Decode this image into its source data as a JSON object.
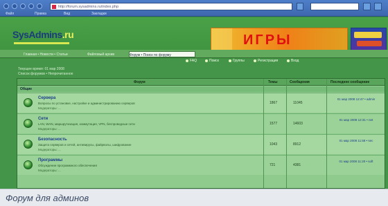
{
  "browser": {
    "url": "http://forum.sysadmins.ru/index.php",
    "menu": [
      "Файл",
      "Правка",
      "Вид",
      "Закладки"
    ]
  },
  "header": {
    "logo_main": "SysAdmins",
    "logo_tld": ".ru",
    "banner_text": "ИГРЫ"
  },
  "tabs": [
    {
      "label": "Главная • Новости • Статьи"
    },
    {
      "label": "Файловый архив"
    },
    {
      "label": "Форум • Поиск по форуму"
    },
    {
      "label": ""
    }
  ],
  "actions": [
    "FAQ",
    "Поиск",
    "Группы",
    "Регистрация",
    "Вход"
  ],
  "crumbs": {
    "line1": "Текущее время: 01 мар 2008",
    "line2": "Список форумов • Непрочитанное"
  },
  "table": {
    "headers": {
      "forum": "Форум",
      "topics": "Темы",
      "posts": "Сообщения",
      "last": "Последнее сообщение"
    },
    "category": "Общие",
    "rows": [
      {
        "title": "Сервера",
        "desc": "Вопросы по установке, настройке и администрированию серверов",
        "mods": "Модераторы: ...",
        "topics": "1867",
        "posts": "11045",
        "last": "01 мар 2008 12:47 • admin"
      },
      {
        "title": "Сети",
        "desc": "LAN, WAN, маршрутизация, коммутация, VPN, беспроводные сети",
        "mods": "Модераторы: ...",
        "topics": "1577",
        "posts": "14603",
        "last": "01 мар 2008 12:31 • net"
      },
      {
        "title": "Безопасность",
        "desc": "Защита серверов и сетей, антивирусы, файрволы, шифрование",
        "mods": "Модераторы: ...",
        "topics": "1043",
        "posts": "8912",
        "last": "01 мар 2008 11:58 • sec"
      },
      {
        "title": "Программы",
        "desc": "Обсуждение программного обеспечения",
        "mods": "Модераторы: ...",
        "topics": "721",
        "posts": "4381",
        "last": "01 мар 2008 11:20 • soft"
      }
    ]
  },
  "caption": "Форум для админов"
}
